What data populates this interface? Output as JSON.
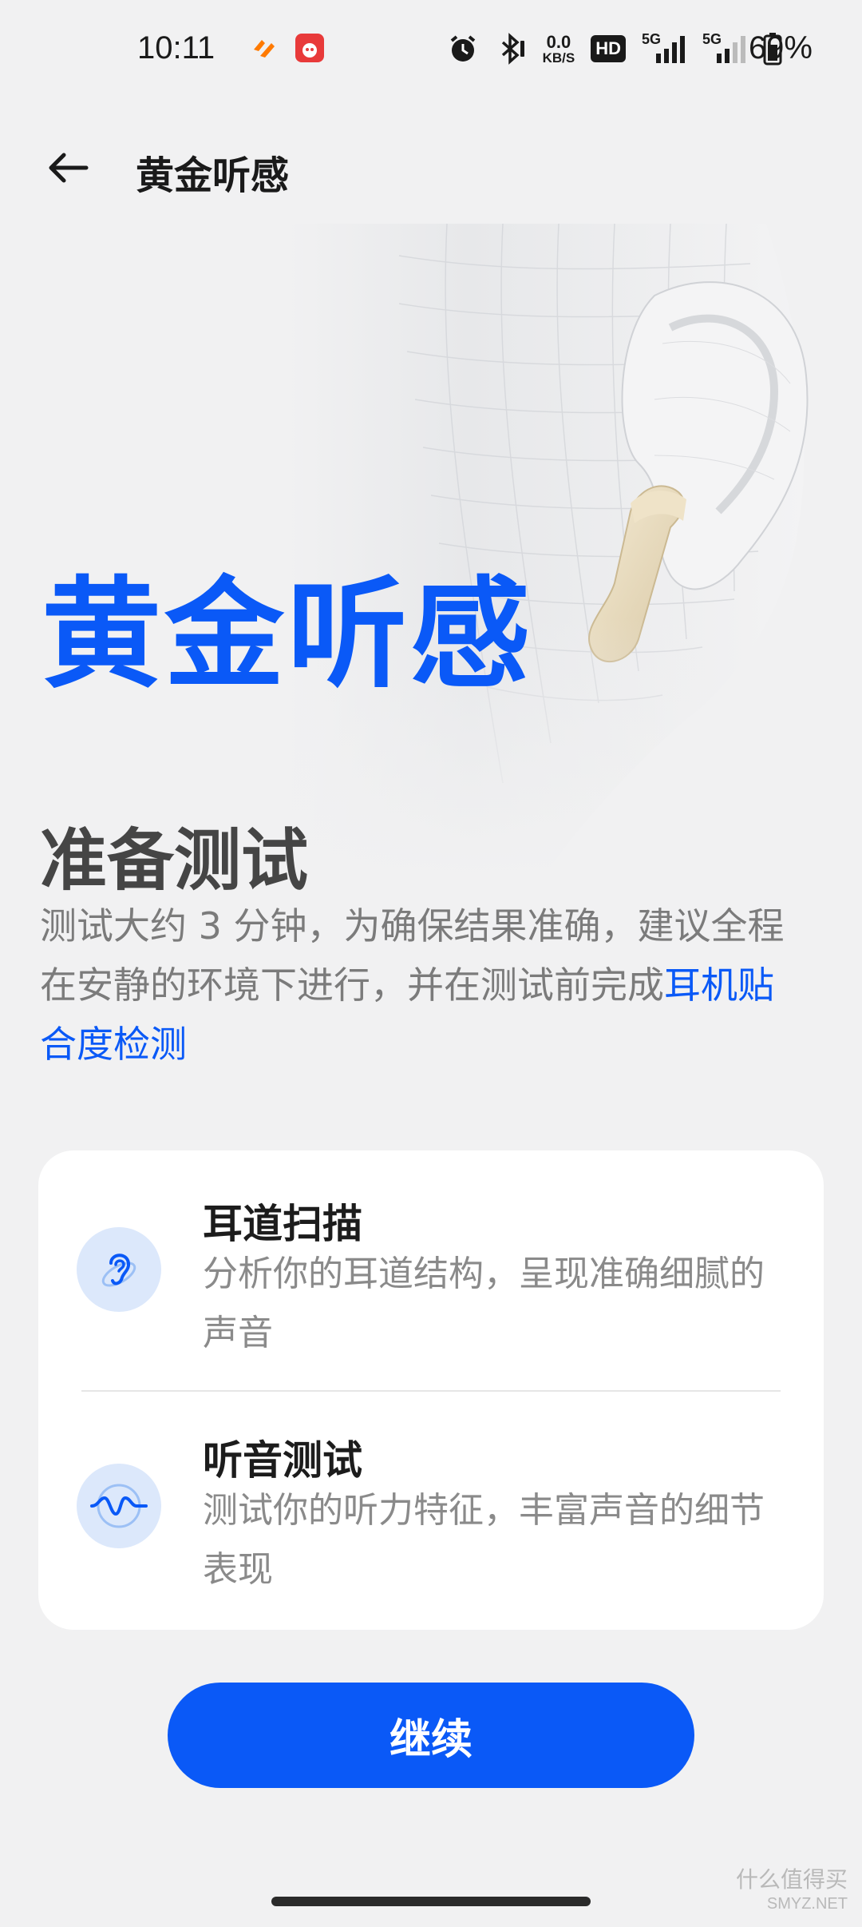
{
  "status_bar": {
    "time": "10:11",
    "net_speed_value": "0.0",
    "net_speed_unit": "KB/S",
    "hd_label": "HD",
    "signal_1_label": "5G",
    "signal_2_label": "5G",
    "battery": "69%",
    "icons": [
      "taobao-app-icon",
      "app-notification-icon",
      "alarm-icon",
      "bluetooth-icon",
      "net-speed",
      "hd-icon",
      "signal-5g-icon",
      "signal-5g-icon",
      "battery-icon"
    ]
  },
  "header": {
    "back_icon": "arrow-left-icon",
    "title": "黄金听感"
  },
  "hero": {
    "title": "黄金听感",
    "image": "head-with-earbud-illustration"
  },
  "intro": {
    "section_title": "准备测试",
    "description": "测试大约 3 分钟，为确保结果准确，建议全程在安静的环境下进行，并在测试前完成",
    "link_text": "耳机贴合度检测"
  },
  "features": [
    {
      "icon": "ear-icon",
      "title": "耳道扫描",
      "desc": "分析你的耳道结构，呈现准确细腻的声音"
    },
    {
      "icon": "sound-wave-icon",
      "title": "听音测试",
      "desc": "测试你的听力特征，丰富声音的细节表现"
    }
  ],
  "continue_button": {
    "label": "继续"
  },
  "watermark": {
    "line1": "什么值得买",
    "line2": "SMYZ.NET"
  },
  "colors": {
    "accent": "#0a59f7",
    "background": "#f1f1f2",
    "card": "#ffffff",
    "icon_bg": "#dce8fb"
  }
}
